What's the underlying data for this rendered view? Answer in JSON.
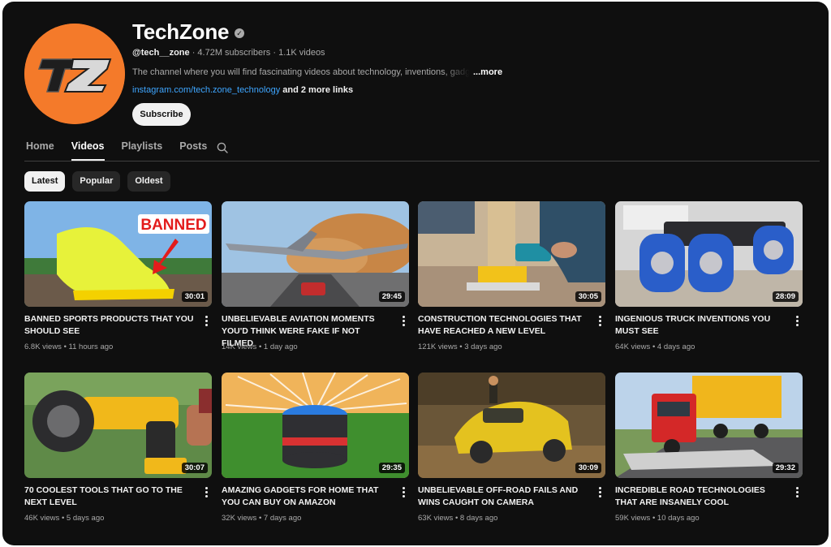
{
  "channel": {
    "name": "TechZone",
    "logo_text": "TZ",
    "handle": "@tech__zone",
    "subscribers": "4.72M subscribers",
    "videos_count": "1.1K videos",
    "separator": " · ",
    "description": "The channel where you will find fascinating videos about technology, inventions, gadgets",
    "more_label": "...more",
    "link": "instagram.com/tech.zone_technology",
    "more_links": " and 2 more links",
    "subscribe_label": "Subscribe"
  },
  "tabs": [
    {
      "label": "Home"
    },
    {
      "label": "Videos"
    },
    {
      "label": "Playlists"
    },
    {
      "label": "Posts"
    }
  ],
  "chips": [
    {
      "label": "Latest"
    },
    {
      "label": "Popular"
    },
    {
      "label": "Oldest"
    }
  ],
  "videos": [
    {
      "title": "BANNED SPORTS PRODUCTS THAT YOU SHOULD SEE",
      "views": "6.8K views",
      "age": "11 hours ago",
      "duration": "30:01",
      "thumb_text": "BANNED"
    },
    {
      "title": "UNBELIEVABLE AVIATION MOMENTS YOU'D THINK WERE FAKE IF NOT FILMED",
      "views": "14K views",
      "age": "1 day ago",
      "duration": "29:45"
    },
    {
      "title": "CONSTRUCTION TECHNOLOGIES THAT HAVE REACHED A NEW LEVEL",
      "views": "121K views",
      "age": "3 days ago",
      "duration": "30:05"
    },
    {
      "title": "INGENIOUS TRUCK INVENTIONS YOU MUST SEE",
      "views": "64K views",
      "age": "4 days ago",
      "duration": "28:09"
    },
    {
      "title": "70 COOLEST TOOLS THAT GO TO THE NEXT LEVEL",
      "views": "46K views",
      "age": "5 days ago",
      "duration": "30:07"
    },
    {
      "title": "AMAZING GADGETS FOR HOME THAT YOU CAN BUY ON AMAZON",
      "views": "32K views",
      "age": "7 days ago",
      "duration": "29:35"
    },
    {
      "title": "UNBELIEVABLE OFF-ROAD FAILS AND WINS CAUGHT ON CAMERA",
      "views": "63K views",
      "age": "8 days ago",
      "duration": "30:09"
    },
    {
      "title": "INCREDIBLE ROAD TECHNOLOGIES THAT ARE INSANELY COOL",
      "views": "59K views",
      "age": "10 days ago",
      "duration": "29:32"
    }
  ],
  "stats_separator": " • ",
  "colors": {
    "background": "#0f0f0f",
    "accent_orange": "#f47a2a",
    "link_blue": "#3ea6ff",
    "chip_bg": "#272727",
    "text_primary": "#f1f1f1",
    "text_secondary": "#aaaaaa"
  },
  "icons": [
    "verified-icon",
    "search-icon",
    "more-vert-icon"
  ]
}
